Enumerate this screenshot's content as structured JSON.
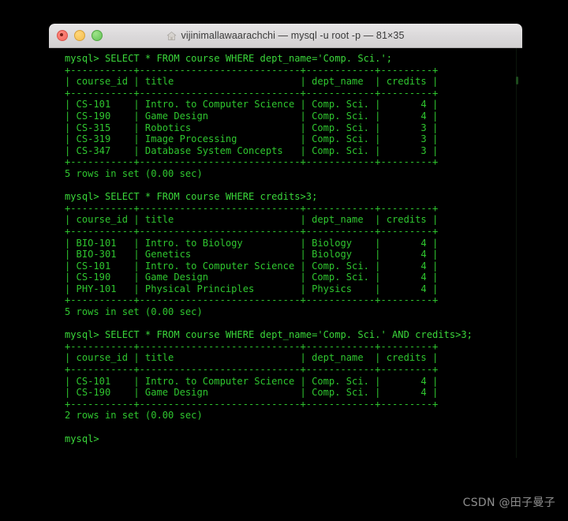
{
  "window": {
    "title": "vijinimallawaarachchi — mysql -u root -p — 81×35",
    "home_icon": "home-icon",
    "traffic_lights": {
      "close_label": "close",
      "minimize_label": "minimize",
      "maximize_label": "maximize",
      "close_color": "#f2685f",
      "minimize_color": "#f4bd4f",
      "maximize_color": "#62c254"
    }
  },
  "theme": {
    "background": "#000000",
    "foreground": "#2fc62f",
    "titlebar_background": "#dcdadb",
    "titlebar_text": "#3a3a3a"
  },
  "terminal": {
    "prompt": "mysql>",
    "lines": [
      "mysql> SELECT * FROM course WHERE dept_name='Comp. Sci.';",
      "+-----------+----------------------------+------------+---------+",
      "| course_id | title                      | dept_name  | credits |",
      "+-----------+----------------------------+------------+---------+",
      "| CS-101    | Intro. to Computer Science | Comp. Sci. |       4 |",
      "| CS-190    | Game Design                | Comp. Sci. |       4 |",
      "| CS-315    | Robotics                   | Comp. Sci. |       3 |",
      "| CS-319    | Image Processing           | Comp. Sci. |       3 |",
      "| CS-347    | Database System Concepts   | Comp. Sci. |       3 |",
      "+-----------+----------------------------+------------+---------+",
      "5 rows in set (0.00 sec)",
      "",
      "mysql> SELECT * FROM course WHERE credits>3;",
      "+-----------+----------------------------+------------+---------+",
      "| course_id | title                      | dept_name  | credits |",
      "+-----------+----------------------------+------------+---------+",
      "| BIO-101   | Intro. to Biology          | Biology    |       4 |",
      "| BIO-301   | Genetics                   | Biology    |       4 |",
      "| CS-101    | Intro. to Computer Science | Comp. Sci. |       4 |",
      "| CS-190    | Game Design                | Comp. Sci. |       4 |",
      "| PHY-101   | Physical Principles        | Physics    |       4 |",
      "+-----------+----------------------------+------------+---------+",
      "5 rows in set (0.00 sec)",
      "",
      "mysql> SELECT * FROM course WHERE dept_name='Comp. Sci.' AND credits>3;",
      "+-----------+----------------------------+------------+---------+",
      "| course_id | title                      | dept_name  | credits |",
      "+-----------+----------------------------+------------+---------+",
      "| CS-101    | Intro. to Computer Science | Comp. Sci. |       4 |",
      "| CS-190    | Game Design                | Comp. Sci. |       4 |",
      "+-----------+----------------------------+------------+---------+",
      "2 rows in set (0.00 sec)",
      "",
      "mysql>"
    ],
    "queries": [
      {
        "sql": "SELECT * FROM course WHERE dept_name='Comp. Sci.';",
        "columns": [
          "course_id",
          "title",
          "dept_name",
          "credits"
        ],
        "rows": [
          [
            "CS-101",
            "Intro. to Computer Science",
            "Comp. Sci.",
            "4"
          ],
          [
            "CS-190",
            "Game Design",
            "Comp. Sci.",
            "4"
          ],
          [
            "CS-315",
            "Robotics",
            "Comp. Sci.",
            "3"
          ],
          [
            "CS-319",
            "Image Processing",
            "Comp. Sci.",
            "3"
          ],
          [
            "CS-347",
            "Database System Concepts",
            "Comp. Sci.",
            "3"
          ]
        ],
        "status": "5 rows in set (0.00 sec)"
      },
      {
        "sql": "SELECT * FROM course WHERE credits>3;",
        "columns": [
          "course_id",
          "title",
          "dept_name",
          "credits"
        ],
        "rows": [
          [
            "BIO-101",
            "Intro. to Biology",
            "Biology",
            "4"
          ],
          [
            "BIO-301",
            "Genetics",
            "Biology",
            "4"
          ],
          [
            "CS-101",
            "Intro. to Computer Science",
            "Comp. Sci.",
            "4"
          ],
          [
            "CS-190",
            "Game Design",
            "Comp. Sci.",
            "4"
          ],
          [
            "PHY-101",
            "Physical Principles",
            "Physics",
            "4"
          ]
        ],
        "status": "5 rows in set (0.00 sec)"
      },
      {
        "sql": "SELECT * FROM course WHERE dept_name='Comp. Sci.' AND credits>3;",
        "columns": [
          "course_id",
          "title",
          "dept_name",
          "credits"
        ],
        "rows": [
          [
            "CS-101",
            "Intro. to Computer Science",
            "Comp. Sci.",
            "4"
          ],
          [
            "CS-190",
            "Game Design",
            "Comp. Sci.",
            "4"
          ]
        ],
        "status": "2 rows in set (0.00 sec)"
      }
    ]
  },
  "watermark": {
    "text": "CSDN @田子曼子"
  }
}
